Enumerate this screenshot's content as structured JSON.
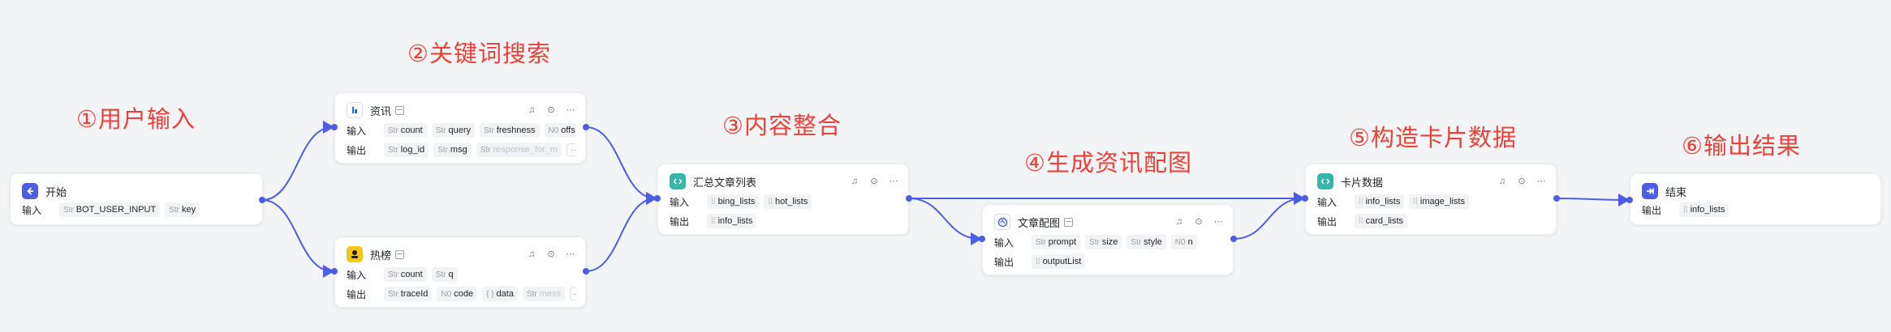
{
  "steps": {
    "s1": "①用户输入",
    "s2": "②关键词搜索",
    "s3": "③内容整合",
    "s4": "④生成资讯配图",
    "s5": "⑤构造卡片数据",
    "s6": "⑥输出结果"
  },
  "labels": {
    "input": "输入",
    "output": "输出",
    "more": "···"
  },
  "colors": {
    "edge": "#4e5ee4",
    "start_icon": "#4e5ee4",
    "code_icon": "#37b5a8",
    "image_icon": "#ffffff",
    "hot_icon": "#f5c518",
    "end_icon": "#4e5ee4",
    "step_text": "#e8423a"
  },
  "nodes": {
    "start": {
      "title": "开始",
      "icon": "start-icon",
      "inputs": [
        {
          "type": "Str",
          "name": "BOT_USER_INPUT"
        },
        {
          "type": "Str",
          "name": "key"
        }
      ]
    },
    "news": {
      "title": "资讯",
      "icon": "news-plugin-icon",
      "inputs": [
        {
          "type": "Str",
          "name": "count"
        },
        {
          "type": "Str",
          "name": "query"
        },
        {
          "type": "Str",
          "name": "freshness"
        },
        {
          "type": "N0",
          "name": "offset"
        }
      ],
      "outputs": [
        {
          "type": "Str",
          "name": "log_id"
        },
        {
          "type": "Str",
          "name": "msg"
        },
        {
          "type": "Str",
          "name": "response_for_m"
        }
      ]
    },
    "hot": {
      "title": "热榜",
      "icon": "hotlist-plugin-icon",
      "inputs": [
        {
          "type": "Str",
          "name": "count"
        },
        {
          "type": "Str",
          "name": "q"
        }
      ],
      "outputs": [
        {
          "type": "Str",
          "name": "traceId"
        },
        {
          "type": "N0",
          "name": "code"
        },
        {
          "type": "{ }",
          "name": "data"
        },
        {
          "type": "Str",
          "name": "mess"
        }
      ]
    },
    "merge": {
      "title": "汇总文章列表",
      "icon": "code-icon",
      "inputs": [
        {
          "type": "⁞⁞",
          "name": "bing_lists"
        },
        {
          "type": "⁞⁞",
          "name": "hot_lists"
        }
      ],
      "outputs": [
        {
          "type": "⁞⁞",
          "name": "info_lists"
        }
      ]
    },
    "image": {
      "title": "文章配图",
      "icon": "image-gen-icon",
      "inputs": [
        {
          "type": "Str",
          "name": "prompt"
        },
        {
          "type": "Str",
          "name": "size"
        },
        {
          "type": "Str",
          "name": "style"
        },
        {
          "type": "N0",
          "name": "n"
        }
      ],
      "outputs": [
        {
          "type": "⁞⁞",
          "name": "outputList"
        }
      ]
    },
    "card": {
      "title": "卡片数据",
      "icon": "code-icon",
      "inputs": [
        {
          "type": "⁞⁞",
          "name": "info_lists"
        },
        {
          "type": "⁞⁞",
          "name": "image_lists"
        }
      ],
      "outputs": [
        {
          "type": "⁞⁞",
          "name": "card_lists"
        }
      ]
    },
    "end": {
      "title": "结束",
      "icon": "end-icon",
      "outputs": [
        {
          "type": "⁞⁞",
          "name": "info_lists"
        }
      ]
    }
  }
}
